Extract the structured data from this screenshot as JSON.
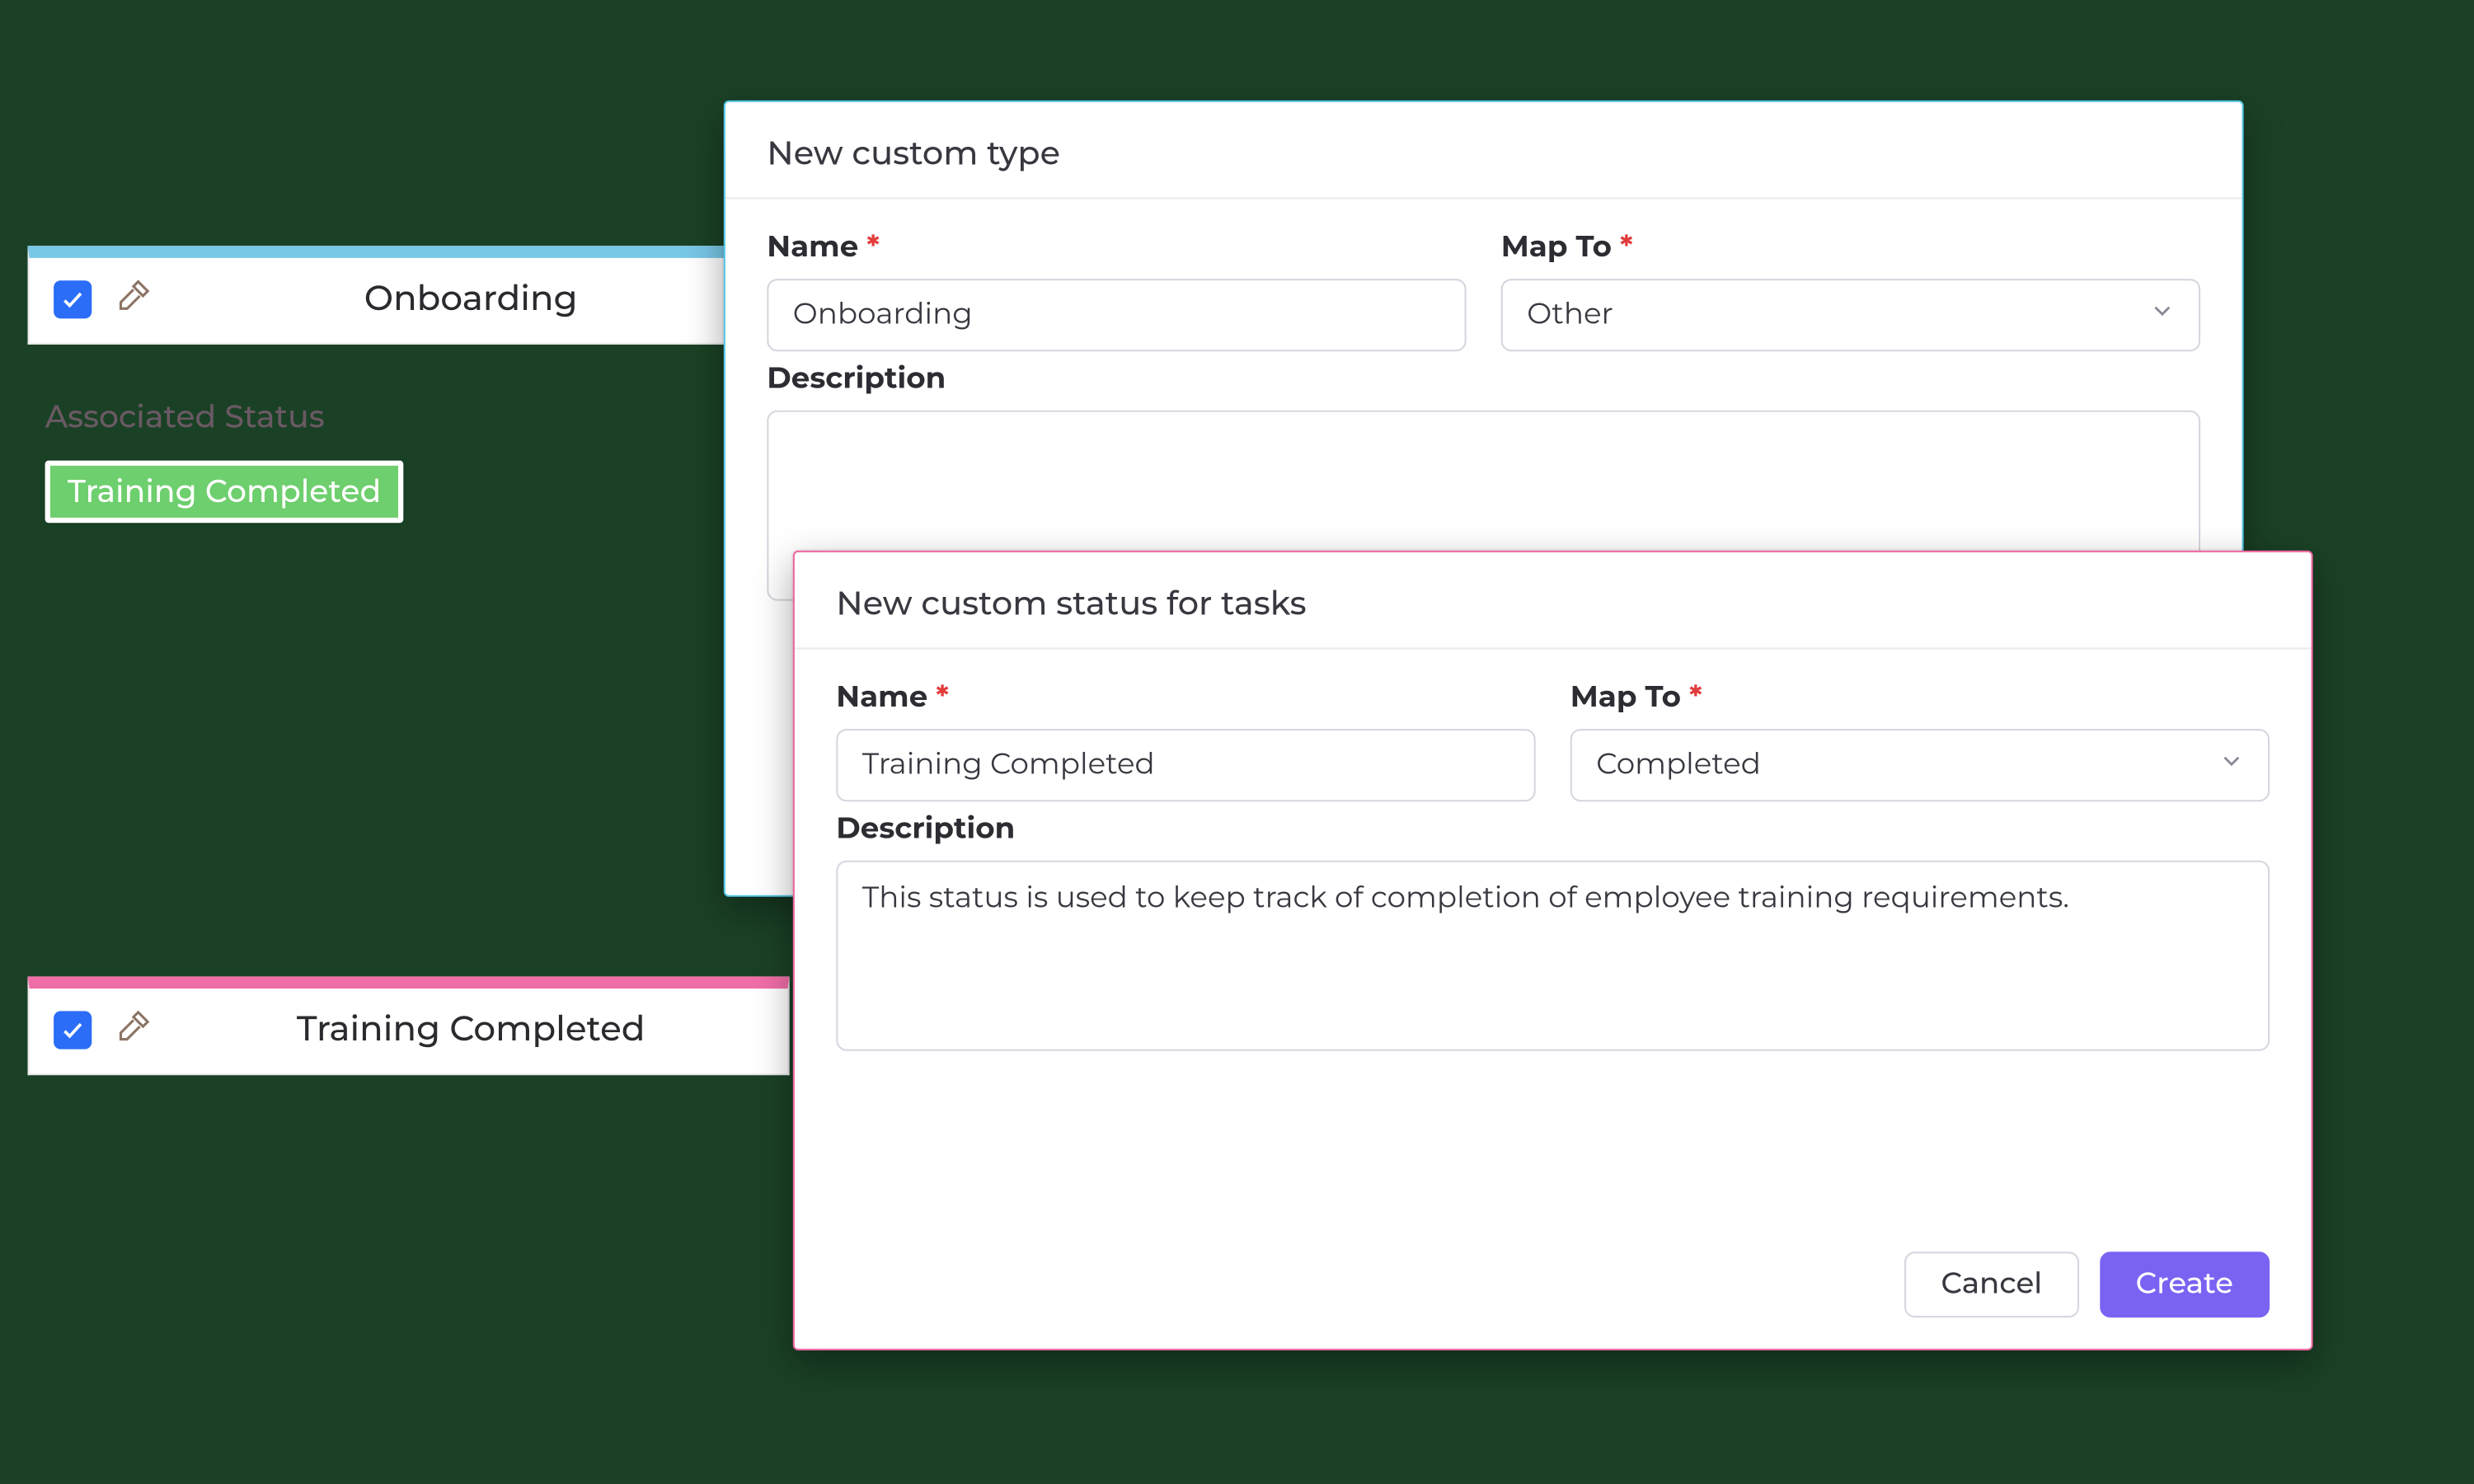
{
  "left": {
    "row_blue_title": "Onboarding",
    "row_pink_title": "Training Completed",
    "assoc_label": "Associated Status",
    "chip_text": "Training Completed"
  },
  "modal_type": {
    "title": "New custom type",
    "name_label": "Name",
    "name_value": "Onboarding",
    "mapto_label": "Map To",
    "mapto_value": "Other",
    "desc_label": "Description",
    "desc_value": ""
  },
  "modal_status": {
    "title": "New custom status for tasks",
    "name_label": "Name",
    "name_value": "Training Completed",
    "mapto_label": "Map To",
    "mapto_value": "Completed",
    "desc_label": "Description",
    "desc_value": "This status is used to keep track of completion of employee training requirements.",
    "cancel": "Cancel",
    "create": "Create"
  },
  "req_mark": "*"
}
